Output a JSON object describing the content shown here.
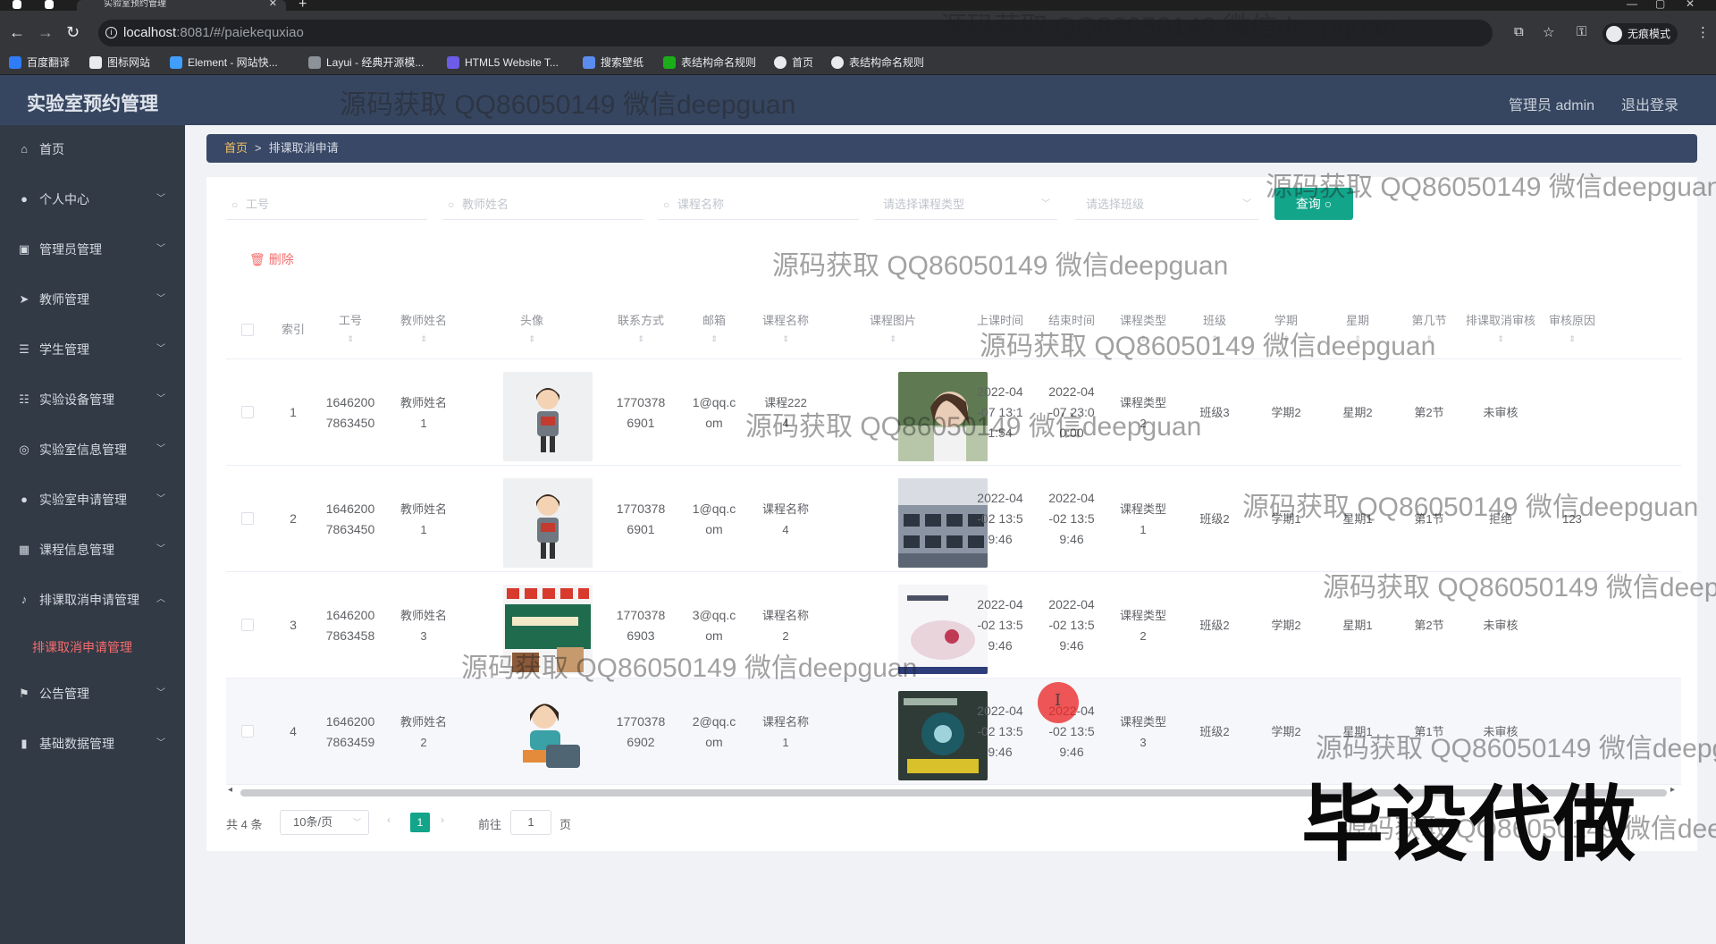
{
  "browser": {
    "tab_title": "实验室预约管理",
    "url_host": "localhost",
    "url_path": ":8081/#/paiekequxiao",
    "profile_label": "无痕模式",
    "bookmarks": [
      "百度翻译",
      "图标网站",
      "Element - 网站快...",
      "Layui - 经典开源模...",
      "HTML5 Website T...",
      "搜索壁纸",
      "表结构命名规则",
      "首页",
      "表结构命名规则"
    ]
  },
  "header": {
    "title": "实验室预约管理",
    "user": "管理员 admin",
    "logout": "退出登录"
  },
  "sidebar": {
    "items": [
      {
        "label": "首页",
        "icon": "home-icon"
      },
      {
        "label": "个人中心",
        "icon": "user-icon"
      },
      {
        "label": "管理员管理",
        "icon": "admin-icon"
      },
      {
        "label": "教师管理",
        "icon": "send-icon"
      },
      {
        "label": "学生管理",
        "icon": "list-icon"
      },
      {
        "label": "实验设备管理",
        "icon": "sliders-icon"
      },
      {
        "label": "实验室信息管理",
        "icon": "globe-icon"
      },
      {
        "label": "实验室申请管理",
        "icon": "user-icon"
      },
      {
        "label": "课程信息管理",
        "icon": "grid-icon"
      },
      {
        "label": "排课取消申请管理",
        "icon": "mic-icon"
      },
      {
        "label": "公告管理",
        "icon": "flag-icon"
      },
      {
        "label": "基础数据管理",
        "icon": "bar-chart-icon"
      }
    ],
    "active_sub": "排课取消申请管理"
  },
  "breadcrumb": {
    "home": "首页",
    "separator": ">",
    "current": "排课取消申请"
  },
  "filters": {
    "staff_no": "工号",
    "teacher_name": "教师姓名",
    "course_name": "课程名称",
    "course_type": "请选择课程类型",
    "class": "请选择班级",
    "query_button": "查询"
  },
  "actions": {
    "delete": "删除"
  },
  "table": {
    "columns": {
      "index": "索引",
      "staff_no": "工号",
      "teacher_name": "教师姓名",
      "avatar": "头像",
      "phone": "联系方式",
      "email": "邮箱",
      "course_name": "课程名称",
      "course_image": "课程图片",
      "start_time": "上课时间",
      "end_time": "结束时间",
      "course_type": "课程类型",
      "class": "班级",
      "semester": "学期",
      "weekday": "星期",
      "section": "第几节",
      "review": "排课取消审核",
      "reason": "审核原因"
    },
    "rows": [
      {
        "index": "1",
        "staff_no": [
          "1646200",
          "7863450"
        ],
        "teacher_name": [
          "教师姓名",
          "1"
        ],
        "phone": [
          "1770378",
          "6901"
        ],
        "email": [
          "1@qq.c",
          "om"
        ],
        "course_name": [
          "课程222",
          "4"
        ],
        "start_time": [
          "2022-04",
          "-07 13:1",
          "1:54"
        ],
        "end_time": [
          "2022-04",
          "-07 23:0",
          "0:00"
        ],
        "course_type": [
          "课程类型",
          "2"
        ],
        "class": "班级3",
        "semester": "学期2",
        "weekday": "星期2",
        "section": "第2节",
        "review": "未审核",
        "reason": ""
      },
      {
        "index": "2",
        "staff_no": [
          "1646200",
          "7863450"
        ],
        "teacher_name": [
          "教师姓名",
          "1"
        ],
        "phone": [
          "1770378",
          "6901"
        ],
        "email": [
          "1@qq.c",
          "om"
        ],
        "course_name": [
          "课程名称",
          "4"
        ],
        "start_time": [
          "2022-04",
          "-02 13:5",
          "9:46"
        ],
        "end_time": [
          "2022-04",
          "-02 13:5",
          "9:46"
        ],
        "course_type": [
          "课程类型",
          "1"
        ],
        "class": "班级2",
        "semester": "学期1",
        "weekday": "星期1",
        "section": "第1节",
        "review": "拒绝",
        "reason": "123"
      },
      {
        "index": "3",
        "staff_no": [
          "1646200",
          "7863458"
        ],
        "teacher_name": [
          "教师姓名",
          "3"
        ],
        "phone": [
          "1770378",
          "6903"
        ],
        "email": [
          "3@qq.c",
          "om"
        ],
        "course_name": [
          "课程名称",
          "2"
        ],
        "start_time": [
          "2022-04",
          "-02 13:5",
          "9:46"
        ],
        "end_time": [
          "2022-04",
          "-02 13:5",
          "9:46"
        ],
        "course_type": [
          "课程类型",
          "2"
        ],
        "class": "班级2",
        "semester": "学期2",
        "weekday": "星期1",
        "section": "第2节",
        "review": "未审核",
        "reason": ""
      },
      {
        "index": "4",
        "staff_no": [
          "1646200",
          "7863459"
        ],
        "teacher_name": [
          "教师姓名",
          "2"
        ],
        "phone": [
          "1770378",
          "6902"
        ],
        "email": [
          "2@qq.c",
          "om"
        ],
        "course_name": [
          "课程名称",
          "1"
        ],
        "start_time": [
          "2022-04",
          "-02 13:5",
          "9:46"
        ],
        "end_time": [
          "2022-04",
          "-02 13:5",
          "9:46"
        ],
        "course_type": [
          "课程类型",
          "3"
        ],
        "class": "班级2",
        "semester": "学期2",
        "weekday": "星期1",
        "section": "第1节",
        "review": "未审核",
        "reason": ""
      }
    ]
  },
  "pagination": {
    "total": "共 4 条",
    "page_size": "10条/页",
    "current_page": "1",
    "goto_label": "前往",
    "goto_value": "1",
    "page_label": "页"
  },
  "overlay": {
    "watermark": "源码获取 QQ86050149 微信deepguan",
    "stamp": "毕设代做"
  }
}
